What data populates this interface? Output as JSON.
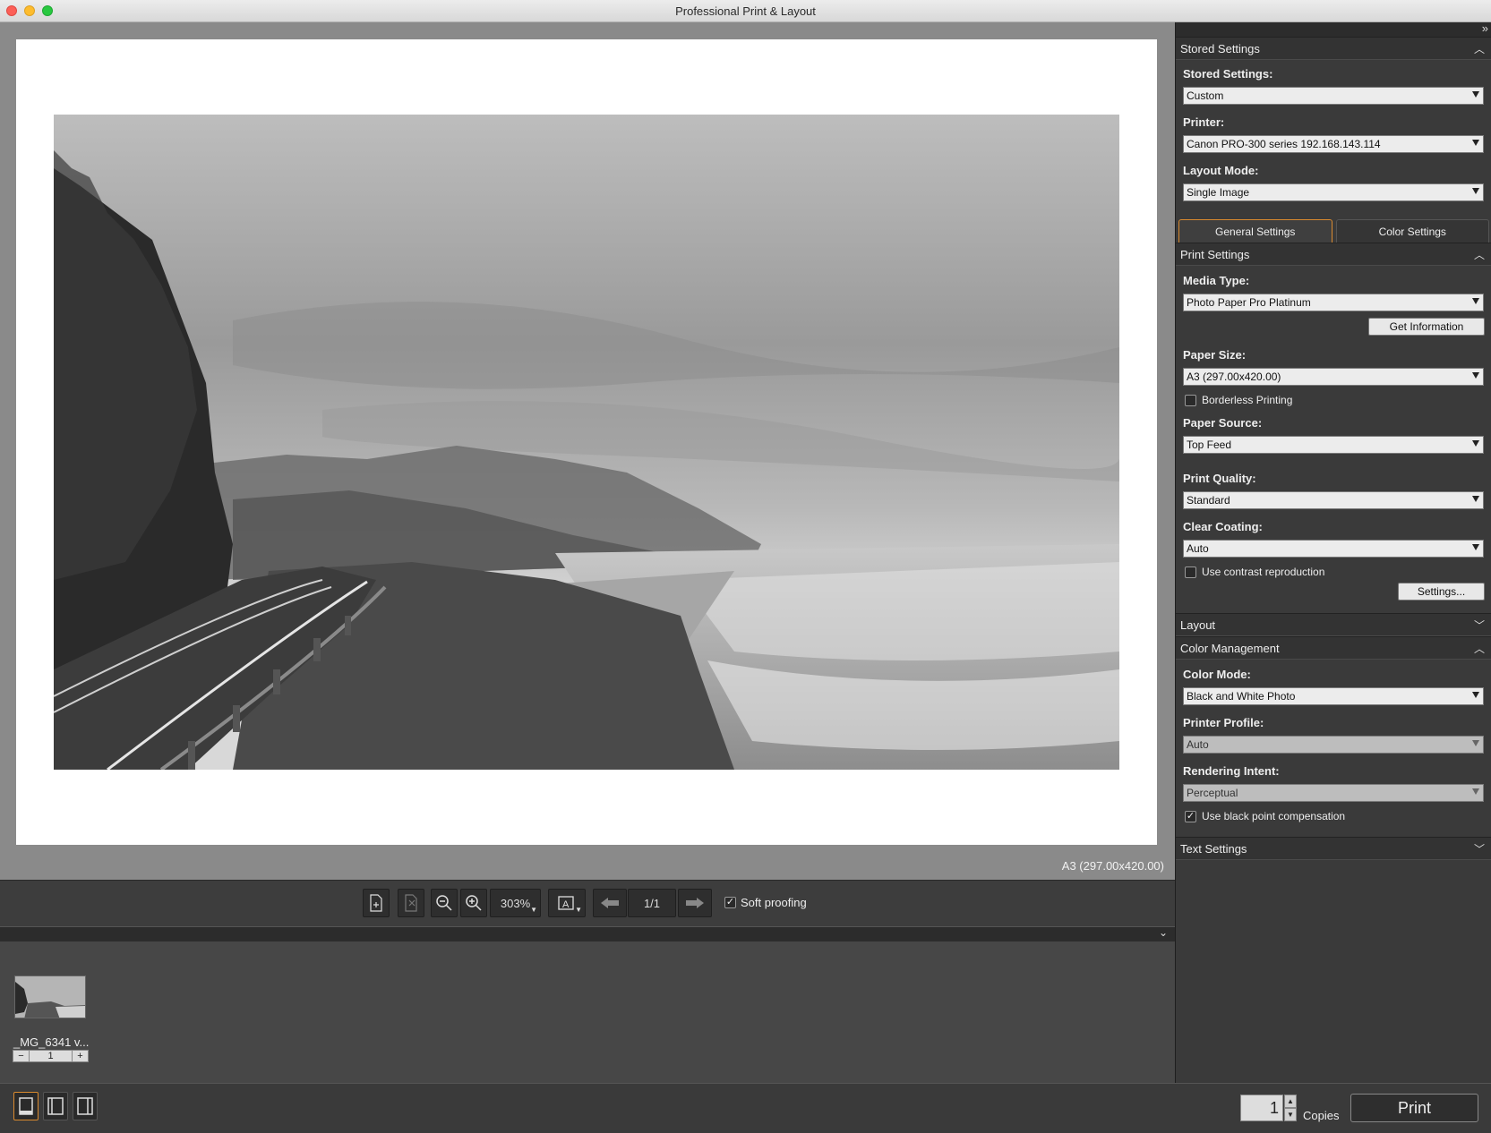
{
  "window": {
    "title": "Professional Print & Layout"
  },
  "preview": {
    "paper_size": "A3 (297.00x420.00)"
  },
  "toolbar": {
    "zoom": "303%",
    "page": "1/1",
    "soft_proofing_label": "Soft proofing",
    "soft_proofing_checked": true
  },
  "thumbnail": {
    "name": "_MG_6341 v...",
    "count": "1",
    "minus": "−",
    "plus": "+"
  },
  "bottom": {
    "copies_value": "1",
    "copies_label": "Copies",
    "print_label": "Print"
  },
  "panel": {
    "stored_settings_section": "Stored Settings",
    "stored_settings_label": "Stored Settings:",
    "stored_settings_value": "Custom",
    "printer_label": "Printer:",
    "printer_value": "Canon PRO-300 series 192.168.143.114",
    "layout_mode_label": "Layout Mode:",
    "layout_mode_value": "Single Image",
    "tabs": {
      "general": "General Settings",
      "color": "Color Settings"
    },
    "print_settings_section": "Print Settings",
    "media_type_label": "Media Type:",
    "media_type_value": "Photo Paper Pro Platinum",
    "get_information": "Get Information",
    "paper_size_label": "Paper Size:",
    "paper_size_value": "A3 (297.00x420.00)",
    "borderless_label": "Borderless Printing",
    "borderless_checked": false,
    "paper_source_label": "Paper Source:",
    "paper_source_value": "Top Feed",
    "print_quality_label": "Print Quality:",
    "print_quality_value": "Standard",
    "clear_coating_label": "Clear Coating:",
    "clear_coating_value": "Auto",
    "contrast_label": "Use contrast reproduction",
    "contrast_checked": false,
    "settings_button": "Settings...",
    "layout_section": "Layout",
    "color_mgmt_section": "Color Management",
    "color_mode_label": "Color Mode:",
    "color_mode_value": "Black and White Photo",
    "printer_profile_label": "Printer Profile:",
    "printer_profile_value": "Auto",
    "rendering_intent_label": "Rendering Intent:",
    "rendering_intent_value": "Perceptual",
    "black_point_label": "Use black point compensation",
    "black_point_checked": true,
    "text_settings_section": "Text Settings"
  },
  "colors": {
    "accent": "#d98a2f",
    "panel_bg": "#3a3a3a",
    "preview_bg": "#8a8a8a"
  }
}
